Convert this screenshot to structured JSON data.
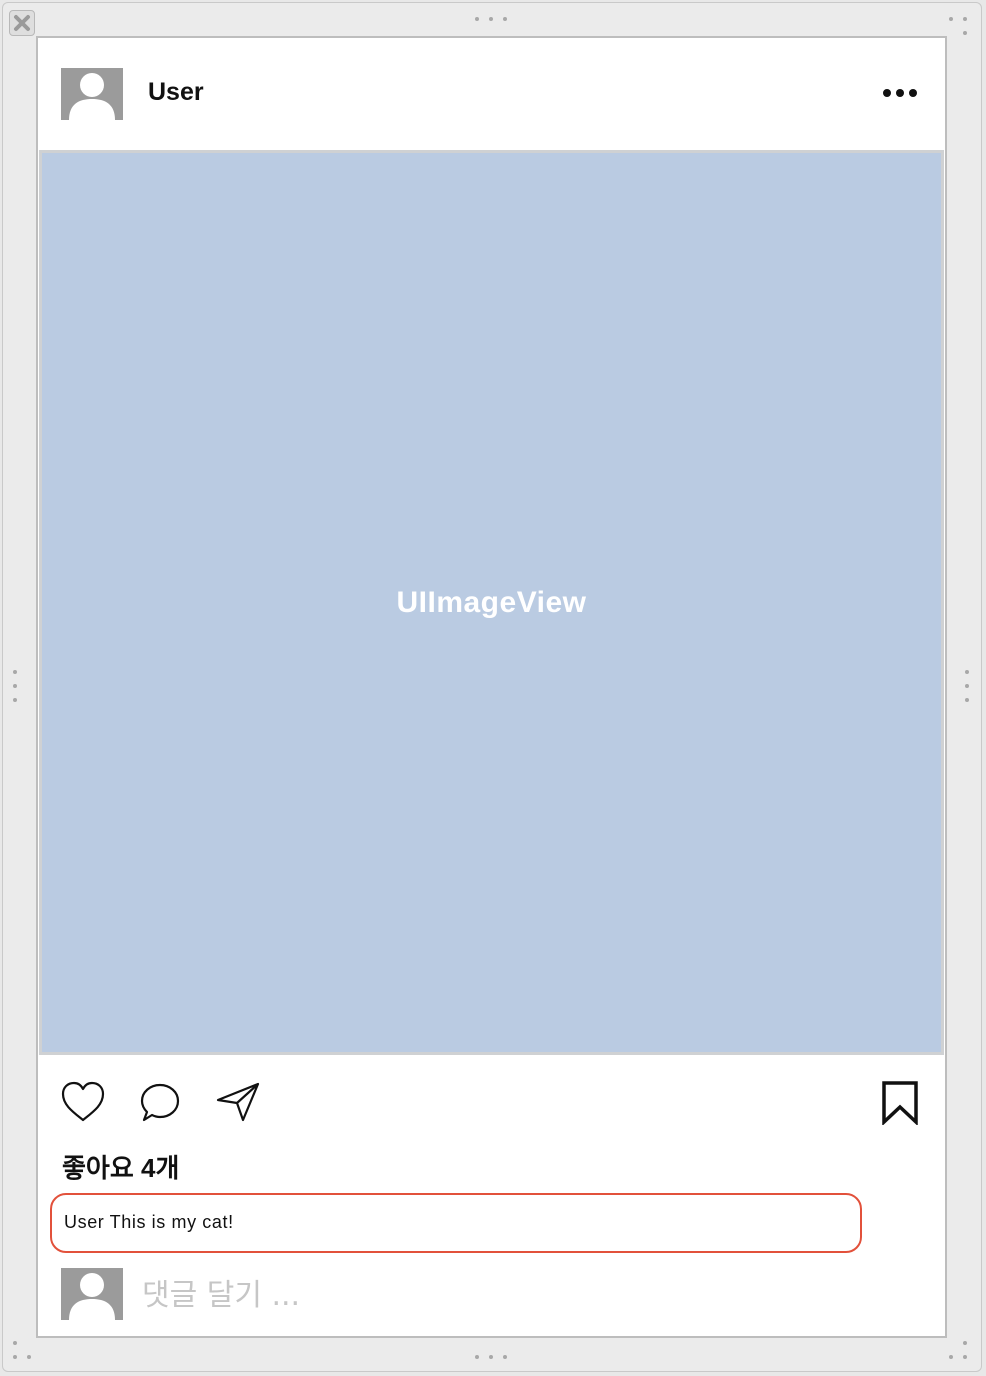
{
  "post": {
    "username": "User",
    "image_label": "UIImageView",
    "likes_text": "좋아요 4개",
    "caption": "User This is my cat!",
    "comment_placeholder": "댓글 달기 ..."
  },
  "icons": {
    "close": "close-icon",
    "avatar": "person-icon",
    "more": "more-dots-icon",
    "like": "heart-icon",
    "comment": "comment-bubble-icon",
    "share": "paper-plane-icon",
    "bookmark": "bookmark-icon"
  },
  "colors": {
    "image_placeholder": "#bacbe2",
    "caption_highlight": "#e2513b",
    "avatar": "#9b9b9b",
    "placeholder_text": "#c6c6c6"
  }
}
